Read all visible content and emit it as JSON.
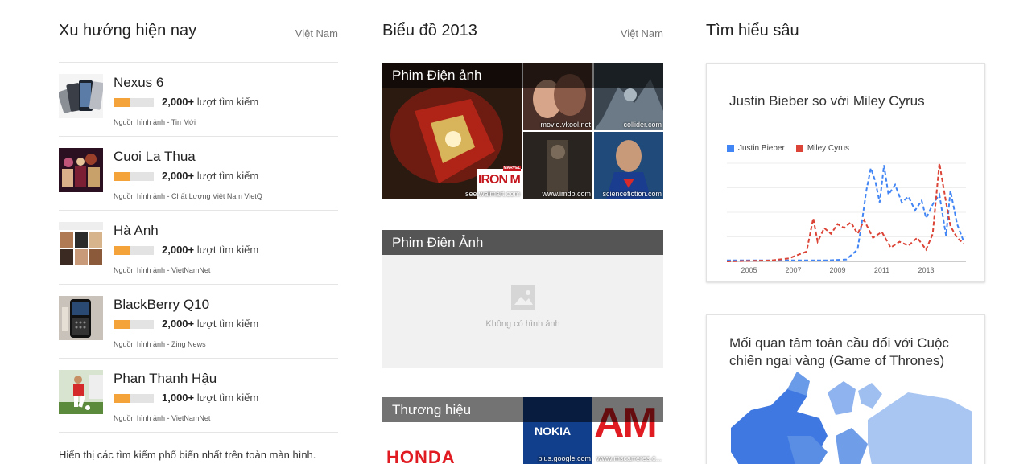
{
  "left": {
    "title": "Xu hướng hiện nay",
    "region": "Việt Nam",
    "items": [
      {
        "name": "Nexus 6",
        "count": "2,000+",
        "count_suffix": "lượt tìm kiếm",
        "fill": 0.4,
        "source": "Nguồn hình ảnh - Tin Mới"
      },
      {
        "name": "Cuoi La Thua",
        "count": "2,000+",
        "count_suffix": "lượt tìm kiếm",
        "fill": 0.4,
        "source": "Nguồn hình ảnh - Chất Lượng Việt Nam VietQ"
      },
      {
        "name": "Hà Anh",
        "count": "2,000+",
        "count_suffix": "lượt tìm kiếm",
        "fill": 0.4,
        "source": "Nguồn hình ảnh - VietNamNet"
      },
      {
        "name": "BlackBerry Q10",
        "count": "2,000+",
        "count_suffix": "lượt tìm kiếm",
        "fill": 0.4,
        "source": "Nguồn hình ảnh - Zing News"
      },
      {
        "name": "Phan Thanh Hậu",
        "count": "1,000+",
        "count_suffix": "lượt tìm kiếm",
        "fill": 0.4,
        "source": "Nguồn hình ảnh - VietNamNet"
      }
    ],
    "footer": "Hiển thị các tìm kiếm phổ biến nhất trên toàn màn hình."
  },
  "middle": {
    "title": "Biểu đồ 2013",
    "region": "Việt Nam",
    "tile1": {
      "label": "Phim Điện ảnh",
      "captions": [
        "see.walmart.com",
        "movie.vkool.net",
        "collider.com",
        "www.imdb.com",
        "sciencefiction.com"
      ],
      "poster_text": "IRON M",
      "poster_brand": "MARVEL"
    },
    "tile2": {
      "label": "Phim Điện Ảnh",
      "no_image": "Không có hình ảnh"
    },
    "tile3": {
      "label": "Thương hiệu",
      "brand1": "HONDA",
      "brand2": "NOKIA",
      "brand3": "AM",
      "captions": [
        "plus.google.com",
        "www.mscarreres.c..."
      ]
    }
  },
  "right": {
    "title": "Tìm hiểu sâu",
    "card1": {
      "title": "Justin Bieber so với Miley Cyrus"
    },
    "card2": {
      "title": "Mối quan tâm toàn cầu đối với Cuộc chiến ngai vàng (Game of Thrones)"
    }
  },
  "chart_data": {
    "type": "line",
    "title": "Justin Bieber so với Miley Cyrus",
    "x_ticks": [
      "2005",
      "2007",
      "2009",
      "2011",
      "2013"
    ],
    "xlim": [
      2004.0,
      2014.8
    ],
    "ylim": [
      0,
      100
    ],
    "series": [
      {
        "name": "Justin Bieber",
        "color": "#4285f4",
        "x": [
          2004.0,
          2008.5,
          2009.4,
          2009.9,
          2010.1,
          2010.3,
          2010.5,
          2010.7,
          2010.9,
          2011.1,
          2011.3,
          2011.6,
          2011.9,
          2012.2,
          2012.5,
          2012.8,
          2013.0,
          2013.3,
          2013.6,
          2013.9,
          2014.1,
          2014.4,
          2014.7
        ],
        "y": [
          1,
          1,
          2,
          12,
          40,
          72,
          95,
          82,
          60,
          98,
          68,
          78,
          60,
          66,
          52,
          62,
          44,
          58,
          68,
          26,
          72,
          38,
          20
        ]
      },
      {
        "name": "Miley Cyrus",
        "color": "#db4437",
        "x": [
          2004.0,
          2006.0,
          2006.8,
          2007.6,
          2007.9,
          2008.1,
          2008.4,
          2008.7,
          2009.0,
          2009.3,
          2009.6,
          2009.9,
          2010.2,
          2010.6,
          2011.0,
          2011.4,
          2011.8,
          2012.2,
          2012.6,
          2013.0,
          2013.3,
          2013.6,
          2013.9,
          2014.1,
          2014.4,
          2014.7
        ],
        "y": [
          0,
          1,
          3,
          10,
          44,
          20,
          34,
          28,
          38,
          34,
          40,
          28,
          42,
          24,
          30,
          14,
          20,
          16,
          24,
          12,
          28,
          100,
          60,
          36,
          24,
          18
        ]
      }
    ]
  }
}
